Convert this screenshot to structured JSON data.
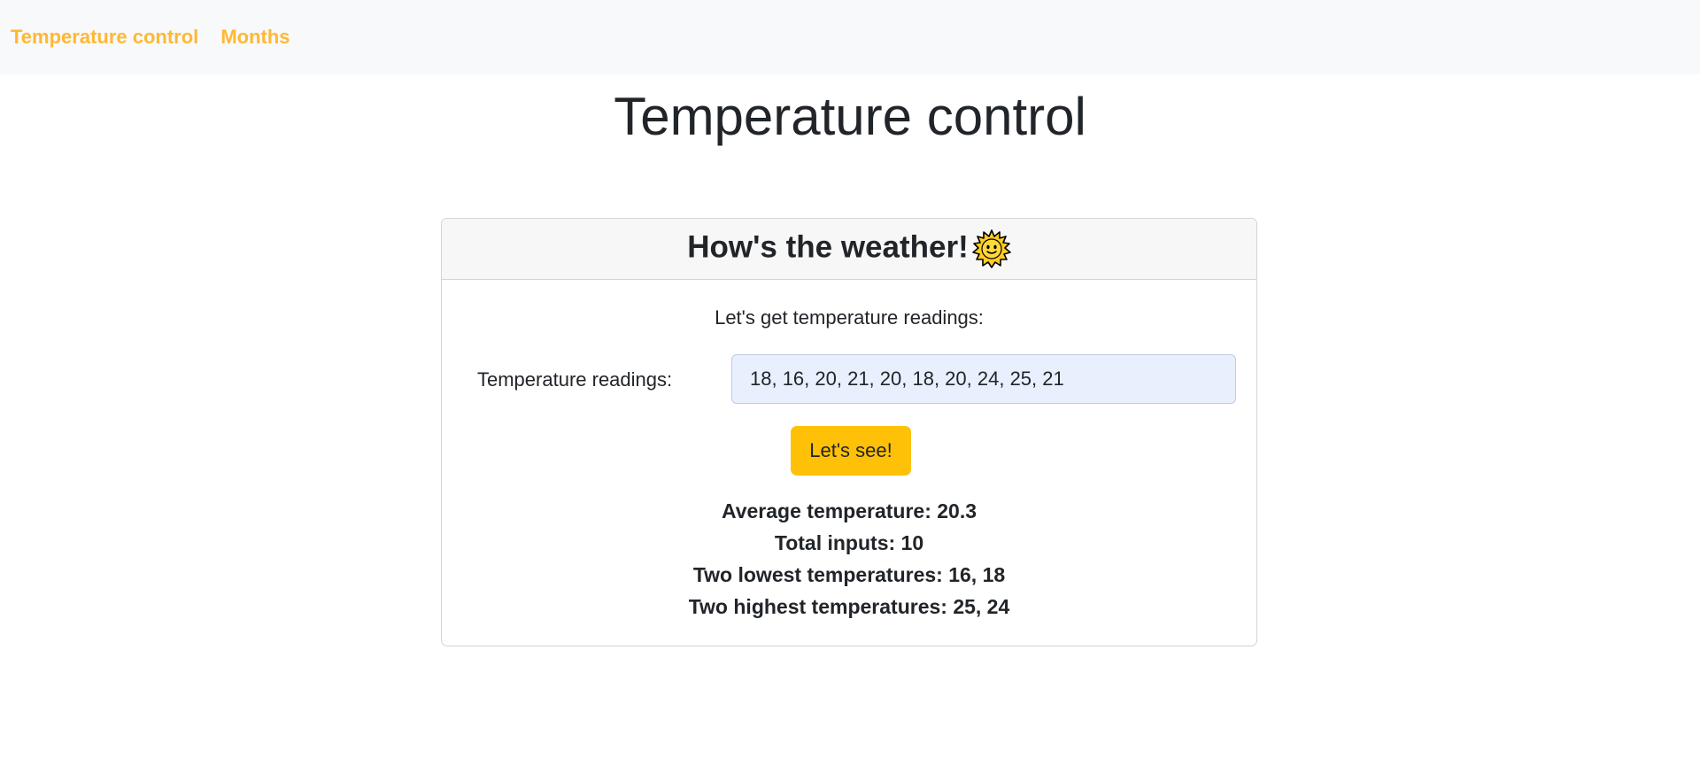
{
  "navbar": {
    "brand": "Temperature control",
    "links": [
      "Months"
    ]
  },
  "page": {
    "title": "Temperature control"
  },
  "card": {
    "header": "How's the weather!",
    "header_icon": "sun-with-face-icon",
    "intro": "Let's get temperature readings:",
    "readings_label": "Temperature readings:",
    "readings_value": "18, 16, 20, 21, 20, 18, 20, 24, 25, 21",
    "submit_label": "Let's see!",
    "results": {
      "average": "Average temperature: 20.3",
      "total": "Total inputs: 10",
      "lowest": "Two lowest temperatures: 16, 18",
      "highest": "Two highest temperatures: 25, 24"
    }
  },
  "colors": {
    "accent": "#ffb833",
    "button": "#ffc107",
    "navbar_bg": "#f8f9fa",
    "input_bg": "#e8f0fe"
  }
}
